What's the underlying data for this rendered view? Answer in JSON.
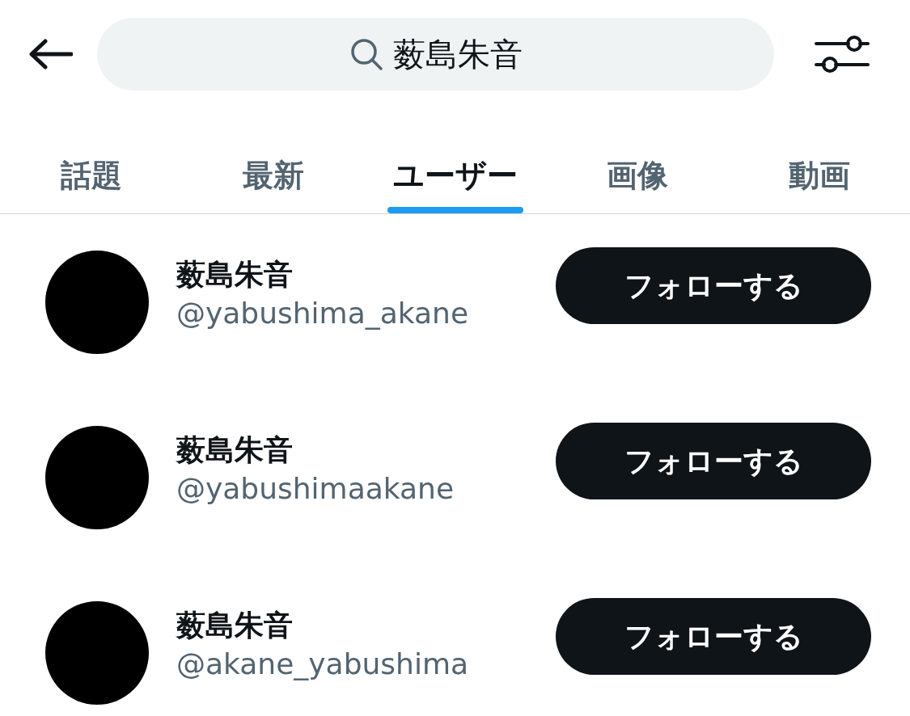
{
  "search": {
    "value": "薮島朱音"
  },
  "tabs": [
    {
      "label": "話題",
      "selected": false
    },
    {
      "label": "最新",
      "selected": false
    },
    {
      "label": "ユーザー",
      "selected": true
    },
    {
      "label": "画像",
      "selected": false
    },
    {
      "label": "動画",
      "selected": false
    }
  ],
  "users": [
    {
      "name": "薮島朱音",
      "handle": "@yabushima_akane",
      "button": "フォローする"
    },
    {
      "name": "薮島朱音",
      "handle": "@yabushimaakane",
      "button": "フォローする"
    },
    {
      "name": "薮島朱音",
      "handle": "@akane_yabushima",
      "button": "フォローする"
    }
  ]
}
